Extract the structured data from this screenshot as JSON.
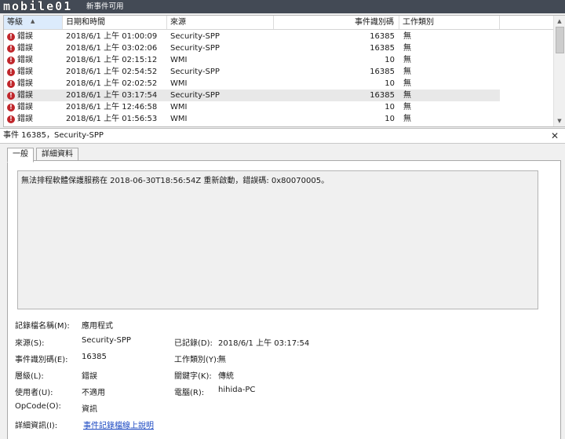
{
  "titlebar": {
    "watermark": "mobile01",
    "text_left": "應用程式",
    "text_right": "新事件可用"
  },
  "list": {
    "columns": [
      "等級",
      "日期和時間",
      "來源",
      "事件識別碼",
      "工作類別"
    ],
    "rows": [
      {
        "level": "錯誤",
        "datetime": "2018/6/1 上午 01:00:09",
        "source": "Security-SPP",
        "event_id": "16385",
        "category": "無",
        "selected": false
      },
      {
        "level": "錯誤",
        "datetime": "2018/6/1 上午 03:02:06",
        "source": "Security-SPP",
        "event_id": "16385",
        "category": "無",
        "selected": false
      },
      {
        "level": "錯誤",
        "datetime": "2018/6/1 上午 02:15:12",
        "source": "WMI",
        "event_id": "10",
        "category": "無",
        "selected": false
      },
      {
        "level": "錯誤",
        "datetime": "2018/6/1 上午 02:54:52",
        "source": "Security-SPP",
        "event_id": "16385",
        "category": "無",
        "selected": false
      },
      {
        "level": "錯誤",
        "datetime": "2018/6/1 上午 02:02:52",
        "source": "WMI",
        "event_id": "10",
        "category": "無",
        "selected": false
      },
      {
        "level": "錯誤",
        "datetime": "2018/6/1 上午 03:17:54",
        "source": "Security-SPP",
        "event_id": "16385",
        "category": "無",
        "selected": true
      },
      {
        "level": "錯誤",
        "datetime": "2018/6/1 上午 12:46:58",
        "source": "WMI",
        "event_id": "10",
        "category": "無",
        "selected": false
      },
      {
        "level": "錯誤",
        "datetime": "2018/6/1 上午 01:56:53",
        "source": "WMI",
        "event_id": "10",
        "category": "無",
        "selected": false
      }
    ]
  },
  "detail": {
    "title": "事件 16385，Security-SPP",
    "tabs": [
      "一般",
      "詳細資料"
    ],
    "active_tab": "一般",
    "description": "無法排程軟體保護服務在 2018-06-30T18:56:54Z 重新啟動，錯誤碼: 0x80070005。",
    "fields": {
      "log_name_label": "記錄檔名稱(M):",
      "log_name": "應用程式",
      "source_label": "來源(S):",
      "source": "Security-SPP",
      "logged_label": "已記錄(D):",
      "logged": "2018/6/1 上午 03:17:54",
      "event_id_label": "事件識別碼(E):",
      "event_id": "16385",
      "task_label": "工作類別(Y):",
      "task": "無",
      "level_label": "層級(L):",
      "level": "錯誤",
      "keywords_label": "關鍵字(K):",
      "keywords": "傳統",
      "user_label": "使用者(U):",
      "user": "不適用",
      "computer_label": "電腦(R):",
      "computer": "hihida-PC",
      "opcode_label": "OpCode(O):",
      "opcode": "資訊",
      "more_info_label": "詳細資訊(I):",
      "more_info_link": "事件記錄檔線上說明"
    }
  },
  "colors": {
    "error_icon": "#c0262b",
    "selected_row": "#e8e8e8",
    "link": "#1b48c2",
    "titlebar": "#434a55"
  }
}
